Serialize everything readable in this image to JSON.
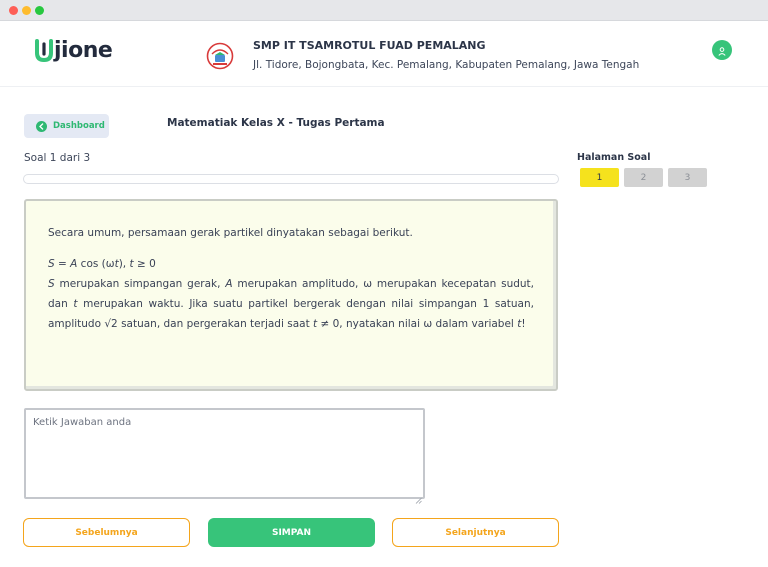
{
  "header": {
    "logo_text": "jione",
    "school_name": "SMP IT TSAMROTUL FUAD PEMALANG",
    "school_address": "Jl. Tidore, Bojongbata, Kec. Pemalang, Kabupaten Pemalang, Jawa Tengah",
    "accent_color": "#37c47a"
  },
  "toolbar": {
    "dashboard_label": "Dashboard",
    "course_title": "Matematiak Kelas X - Tugas Pertama"
  },
  "quiz": {
    "counter": "Soal 1 dari 3",
    "progress": 0,
    "pages_title": "Halaman Soal",
    "pages": [
      "1",
      "2",
      "3"
    ],
    "active_page": "1"
  },
  "question": {
    "intro": "Secara umum, persamaan gerak partikel dinyatakan sebagai berikut.",
    "formula_lhs": "S",
    "formula_eq": " = ",
    "formula_a": "A",
    "formula_cos": " cos (ω",
    "formula_t": "t",
    "formula_close": "), ",
    "formula_t2": "t",
    "formula_cond": " ≥ 0",
    "body_s": "S",
    "body_1": " merupakan simpangan gerak, ",
    "body_a": "A",
    "body_2": " merupakan amplitudo, ω merupakan kecepatan sudut, dan ",
    "body_t": "t",
    "body_3": " merupakan waktu. Jika suatu partikel bergerak dengan nilai simpangan 1 satuan, amplitudo √2 satuan, dan pergerakan terjadi saat ",
    "body_t2": "t",
    "body_4": " ≠ 0, nyatakan nilai ω dalam variabel ",
    "body_t3": "t",
    "body_5": "!"
  },
  "answer": {
    "placeholder": "Ketik Jawaban anda",
    "value": ""
  },
  "nav": {
    "prev_label": "Sebelumnya",
    "save_label": "SIMPAN",
    "next_label": "Selanjutnya"
  }
}
